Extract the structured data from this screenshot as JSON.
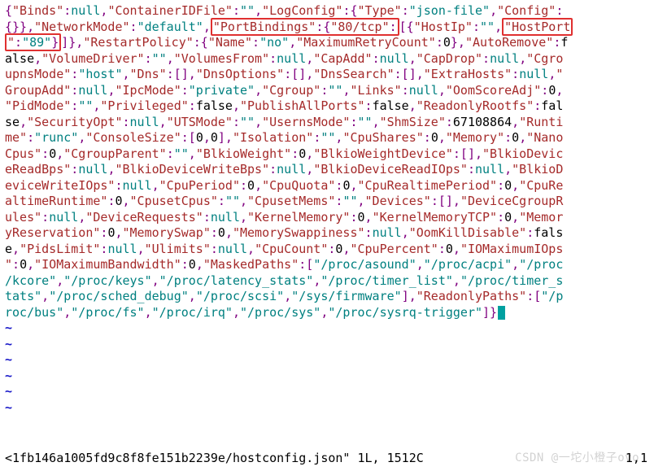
{
  "hostconfig": {
    "Binds": null,
    "ContainerIDFile": "",
    "LogConfig": {
      "Type": "json-file",
      "Config": {}
    },
    "NetworkMode": "default",
    "PortBindings": {
      "80/tcp": [
        {
          "HostIp": "",
          "HostPort": "89"
        }
      ]
    },
    "RestartPolicy": {
      "Name": "no",
      "MaximumRetryCount": 0
    },
    "AutoRemove": false,
    "VolumeDriver": "",
    "VolumesFrom": null,
    "CapAdd": null,
    "CapDrop": null,
    "CgroupnsMode": "host",
    "Dns": [],
    "DnsOptions": [],
    "DnsSearch": [],
    "ExtraHosts": null,
    "GroupAdd": null,
    "IpcMode": "private",
    "Cgroup": "",
    "Links": null,
    "OomScoreAdj": 0,
    "PidMode": "",
    "Privileged": false,
    "PublishAllPorts": false,
    "ReadonlyRootfs": false,
    "SecurityOpt": null,
    "UTSMode": "",
    "UsernsMode": "",
    "ShmSize": 67108864,
    "Runtime": "runc",
    "ConsoleSize": [
      0,
      0
    ],
    "Isolation": "",
    "CpuShares": 0,
    "Memory": 0,
    "NanoCpus": 0,
    "CgroupParent": "",
    "BlkioWeight": 0,
    "BlkioWeightDevice": [],
    "BlkioDeviceReadBps": null,
    "BlkioDeviceWriteBps": null,
    "BlkioDeviceReadIOps": null,
    "BlkioDeviceWriteIOps": null,
    "CpuPeriod": 0,
    "CpuQuota": 0,
    "CpuRealtimePeriod": 0,
    "CpuRealtimeRuntime": 0,
    "CpusetCpus": "",
    "CpusetMems": "",
    "Devices": [],
    "DeviceCgroupRules": null,
    "DeviceRequests": null,
    "KernelMemory": 0,
    "KernelMemoryTCP": 0,
    "MemoryReservation": 0,
    "MemorySwap": 0,
    "MemorySwappiness": null,
    "OomKillDisable": false,
    "PidsLimit": null,
    "Ulimits": null,
    "CpuCount": 0,
    "CpuPercent": 0,
    "IOMaximumIOps": 0,
    "IOMaximumBandwidth": 0,
    "MaskedPaths": [
      "/proc/asound",
      "/proc/acpi",
      "/proc/kcore",
      "/proc/keys",
      "/proc/latency_stats",
      "/proc/timer_list",
      "/proc/timer_stats",
      "/proc/sched_debug",
      "/proc/scsi",
      "/sys/firmware"
    ],
    "ReadonlyPaths": [
      "/proc/bus",
      "/proc/fs",
      "/proc/irq",
      "/proc/sys",
      "/proc/sysrq-trigger"
    ]
  },
  "highlights": [
    "PortBindings",
    "80/tcp",
    "HostPort",
    "89"
  ],
  "status": {
    "filename": "<1fb146a1005fd9c8f8fe151b2239e/hostconfig.json\"",
    "info": "1L, 1512C",
    "pos": "1,1"
  },
  "watermark": "CSDN @一坨小橙子ovo"
}
